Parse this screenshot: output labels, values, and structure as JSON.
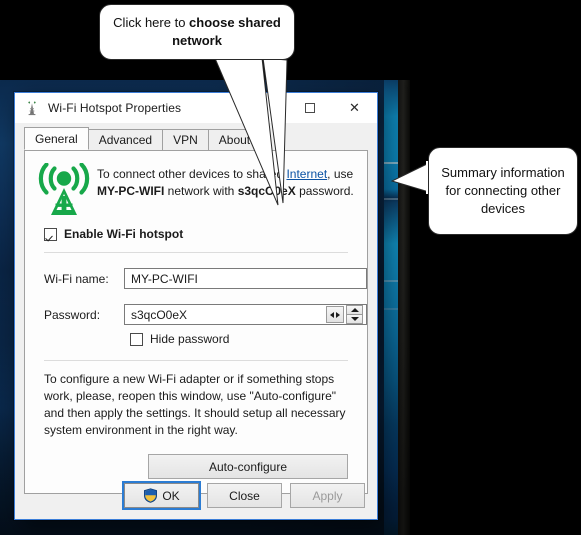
{
  "window": {
    "title": "Wi-Fi Hotspot Properties",
    "title_icon": "antenna-tower-icon",
    "buttons": {
      "maximize_icon": "maximize-square-icon",
      "close_label": "✕"
    }
  },
  "tabs": [
    {
      "label": "General",
      "active": true
    },
    {
      "label": "Advanced",
      "active": false
    },
    {
      "label": "VPN",
      "active": false
    },
    {
      "label": "About",
      "active": false
    }
  ],
  "general": {
    "ap_icon": "wifi-access-point-icon",
    "info": {
      "line1_pre": "To connect other devices to shared ",
      "link": "Internet",
      "line1_post": ", use",
      "network_name": "MY-PC-WIFI",
      "mid": " network with ",
      "password": "s3qcO0eX",
      "line2_post": " password."
    },
    "enable_checkbox": {
      "label": "Enable Wi-Fi hotspot",
      "checked": true
    },
    "fields": {
      "wifi_name_label": "Wi-Fi name:",
      "wifi_name_value": "MY-PC-WIFI",
      "password_label": "Password:",
      "password_value": "s3qcO0eX"
    },
    "hide_password": {
      "label": "Hide password",
      "checked": false
    },
    "paragraph": "To configure a new Wi-Fi adapter or if something stops work, please, reopen this window, use \"Auto-configure\" and then apply the settings. It should setup all necessary system environment in the right way.",
    "auto_configure_label": "Auto-configure"
  },
  "footer": {
    "ok_label": "OK",
    "ok_icon": "uac-shield-icon",
    "close_label": "Close",
    "apply_label": "Apply",
    "apply_enabled": false
  },
  "callouts": {
    "top": {
      "text_plain": "Click here to ",
      "text_bold": "choose shared network"
    },
    "right": {
      "text": "Summary information for connecting other devices"
    }
  },
  "colors": {
    "accent_green": "#17a84a",
    "link_blue": "#0b52a4",
    "dialog_border": "#3b7dd8",
    "focus_blue": "#2b7cd3",
    "dialog_bg": "#f0f0f0",
    "page_bg": "#fdfdfd",
    "shield_blue": "#1c5fb0",
    "shield_gold": "#f2c23c",
    "desktop_dark": "#0b2a4e",
    "desktop_bright": "#12a8e8"
  }
}
